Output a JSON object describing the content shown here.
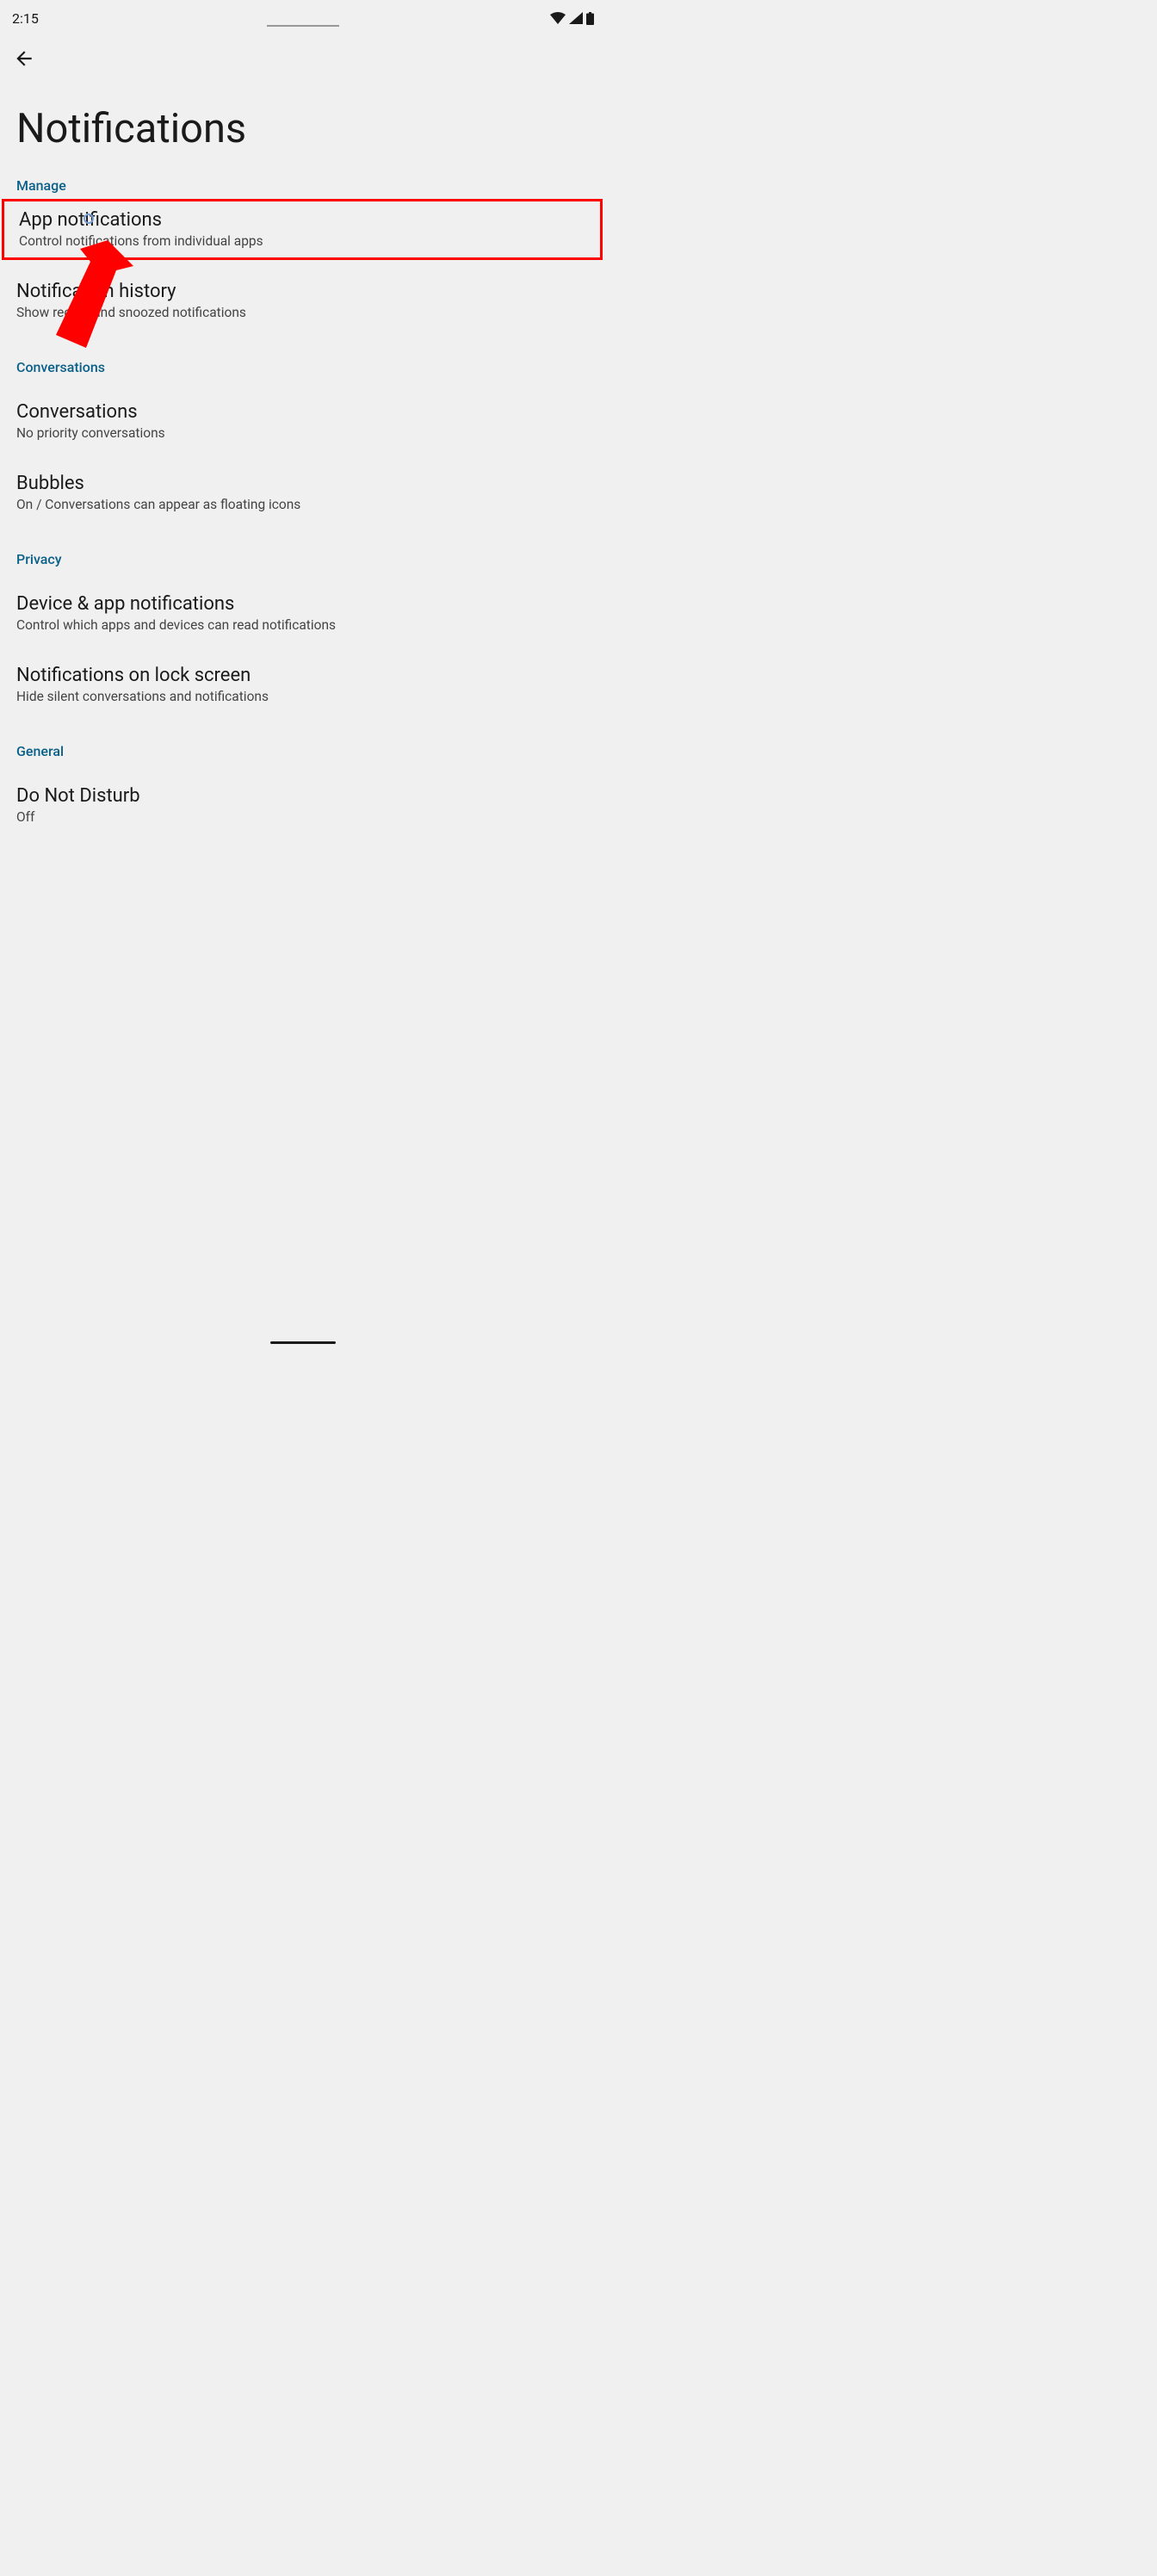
{
  "status": {
    "time": "2:15"
  },
  "page": {
    "title": "Notifications"
  },
  "sections": {
    "manage": {
      "header": "Manage",
      "items": {
        "app_notifications": {
          "title": "App notifications",
          "subtitle": "Control notifications from individual apps"
        },
        "notification_history": {
          "title": "Notification history",
          "subtitle": "Show recent and snoozed notifications"
        }
      }
    },
    "conversations": {
      "header": "Conversations",
      "items": {
        "conversations": {
          "title": "Conversations",
          "subtitle": "No priority conversations"
        },
        "bubbles": {
          "title": "Bubbles",
          "subtitle": "On / Conversations can appear as floating icons"
        }
      }
    },
    "privacy": {
      "header": "Privacy",
      "items": {
        "device_app": {
          "title": "Device & app notifications",
          "subtitle": "Control which apps and devices can read notifications"
        },
        "lock_screen": {
          "title": "Notifications on lock screen",
          "subtitle": "Hide silent conversations and notifications"
        }
      }
    },
    "general": {
      "header": "General",
      "items": {
        "dnd": {
          "title": "Do Not Disturb",
          "subtitle": "Off"
        }
      }
    }
  }
}
